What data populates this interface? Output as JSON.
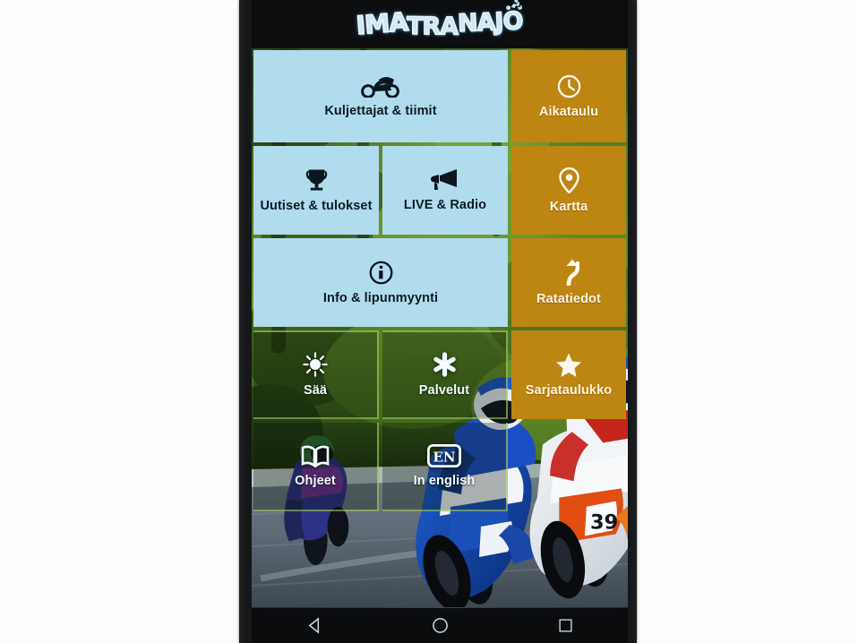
{
  "app": {
    "logo_text": "IMATRANAJO",
    "logo_icon": "motorcycle-rider-icon",
    "platform": "android"
  },
  "colors": {
    "tile_blue": "#b1dced",
    "tile_amber": "#bd8511",
    "tile_ghost_overlay": "rgba(6,18,8,0.30)",
    "ghost_border": "rgba(190,240,110,0.55)",
    "blue_label": "#0d1b24",
    "amber_label": "#fdf4e2",
    "ghost_label": "#f4fbff",
    "screen_background": "#0a0b0d",
    "phone_body": "#151719",
    "page_background": "#ffffff"
  },
  "menu": {
    "tiles": [
      {
        "label": "Kuljettajat & tiimit",
        "icon": "motorcycle-icon",
        "style": "blue"
      },
      {
        "label": "Aikataulu",
        "icon": "clock-icon",
        "style": "amber"
      },
      {
        "label": "Uutiset & tulokset",
        "icon": "trophy-icon",
        "style": "blue"
      },
      {
        "label": "LIVE & Radio",
        "icon": "megaphone-icon",
        "style": "blue"
      },
      {
        "label": "Kartta",
        "icon": "map-pin-icon",
        "style": "amber"
      },
      {
        "label": "Info & lipunmyynti",
        "icon": "info-circle-icon",
        "style": "blue"
      },
      {
        "label": "Ratatiedot",
        "icon": "winding-road-icon",
        "style": "amber"
      },
      {
        "label": "Sää",
        "icon": "sun-icon",
        "style": "ghost"
      },
      {
        "label": "Palvelut",
        "icon": "asterisk-icon",
        "style": "ghost"
      },
      {
        "label": "Sarjataulukko",
        "icon": "star-icon",
        "style": "amber"
      },
      {
        "label": "Ohjeet",
        "icon": "book-icon",
        "style": "ghost"
      },
      {
        "label": "In english",
        "icon": "en-badge-icon",
        "style": "ghost"
      }
    ]
  },
  "background_photo": {
    "description": "Three road-racing motorcycles leaning into a corner on asphalt with blurred green trees behind",
    "riders": [
      {
        "number": "",
        "leathers": "blue and purple",
        "position": "left, furthest back"
      },
      {
        "number": "",
        "leathers": "blue and white",
        "position": "centre"
      },
      {
        "number": "39",
        "leathers": "white, red and orange",
        "position": "right, leading"
      }
    ]
  },
  "navbar": {
    "buttons": [
      {
        "name": "back",
        "icon": "triangle-left-icon"
      },
      {
        "name": "home",
        "icon": "circle-icon"
      },
      {
        "name": "recents",
        "icon": "square-icon"
      }
    ]
  }
}
